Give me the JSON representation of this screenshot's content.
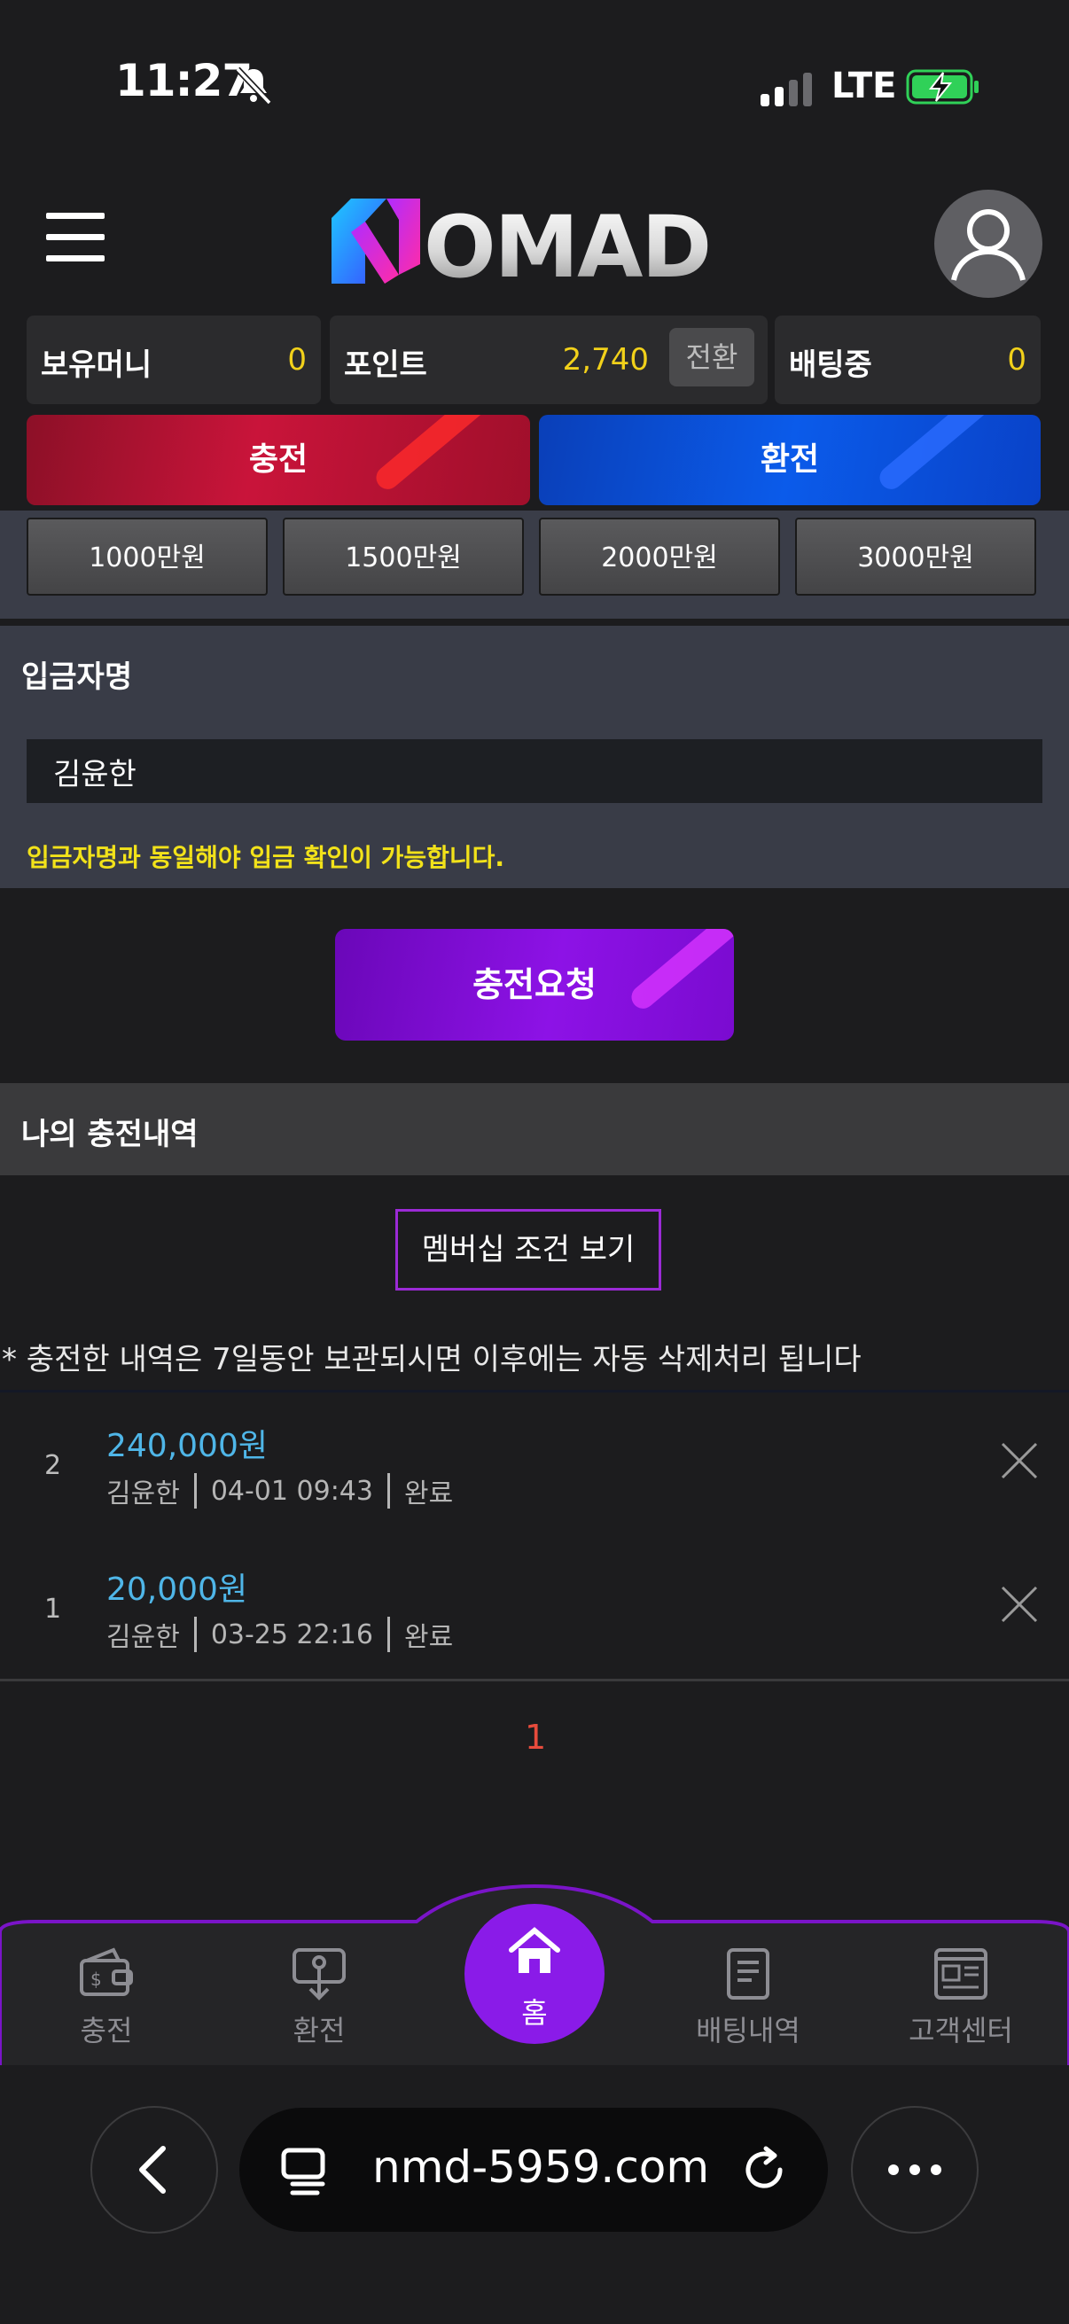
{
  "status": {
    "time": "11:27",
    "network": "LTE"
  },
  "header": {
    "logo_text": "NOMAD"
  },
  "balances": {
    "money_label": "보유머니",
    "money_value": "0",
    "point_label": "포인트",
    "point_value": "2,740",
    "convert_label": "전환",
    "betting_label": "배팅중",
    "betting_value": "0"
  },
  "actions": {
    "deposit": "충전",
    "withdraw": "환전"
  },
  "amount_chips": [
    "1000만원",
    "1500만원",
    "2000만원",
    "3000만원"
  ],
  "depositor": {
    "title": "입금자명",
    "value": "김윤한",
    "note": "입금자명과 동일해야 입금 확인이 가능합니다."
  },
  "request_button": "충전요청",
  "history": {
    "title": "나의 충전내역",
    "membership_button": "멤버십 조건 보기",
    "retention_note": "* 충전한 내역은 7일동안 보관되시면 이후에는 자동 삭제처리 됩니다",
    "rows": [
      {
        "index": "2",
        "amount": "240,000원",
        "name": "김윤한",
        "datetime": "04-01 09:43",
        "status": "완료"
      },
      {
        "index": "1",
        "amount": "20,000원",
        "name": "김윤한",
        "datetime": "03-25 22:16",
        "status": "완료"
      }
    ],
    "current_page": "1"
  },
  "bottom_nav": {
    "deposit": "충전",
    "withdraw": "환전",
    "home": "홈",
    "bet_history": "배팅내역",
    "support": "고객센터"
  },
  "browser": {
    "url": "nmd-5959.com"
  },
  "colors": {
    "background": "#1c1c1e",
    "accent_purple": "#8a1be8",
    "deposit_red": "#c9143a",
    "withdraw_blue": "#0b5bea",
    "highlight_yellow": "#f2d11a",
    "amount_blue": "#4fb6e8",
    "page_red": "#e84b3c"
  }
}
